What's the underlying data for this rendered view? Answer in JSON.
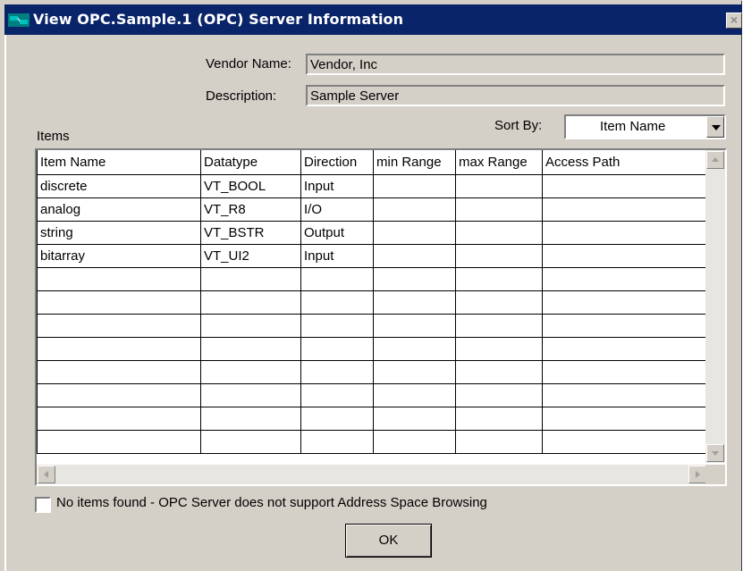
{
  "window": {
    "title": "View OPC.Sample.1 (OPC) Server Information",
    "close_glyph": "×"
  },
  "vendor": {
    "label": "Vendor Name:",
    "value": "Vendor, Inc"
  },
  "description": {
    "label": "Description:",
    "value": "Sample Server"
  },
  "items_label": "Items",
  "sort": {
    "label": "Sort By:",
    "selected": "Item Name"
  },
  "table": {
    "columns": [
      "Item Name",
      "Datatype",
      "Direction",
      "min Range",
      "max Range",
      "Access Path"
    ],
    "rows": [
      [
        "discrete",
        "VT_BOOL",
        "Input",
        "",
        "",
        ""
      ],
      [
        "analog",
        "VT_R8",
        "I/O",
        "",
        "",
        ""
      ],
      [
        "string",
        "VT_BSTR",
        "Output",
        "",
        "",
        ""
      ],
      [
        "bitarray",
        "VT_UI2",
        "Input",
        "",
        "",
        ""
      ],
      [
        "",
        "",
        "",
        "",
        "",
        ""
      ],
      [
        "",
        "",
        "",
        "",
        "",
        ""
      ],
      [
        "",
        "",
        "",
        "",
        "",
        ""
      ],
      [
        "",
        "",
        "",
        "",
        "",
        ""
      ],
      [
        "",
        "",
        "",
        "",
        "",
        ""
      ],
      [
        "",
        "",
        "",
        "",
        "",
        ""
      ],
      [
        "",
        "",
        "",
        "",
        "",
        ""
      ],
      [
        "",
        "",
        "",
        "",
        "",
        ""
      ]
    ]
  },
  "no_items_checkbox": {
    "label": "No items found - OPC Server does not support Address Space Browsing",
    "checked": false
  },
  "ok_button": "OK",
  "colors": {
    "title_bar": "#0a246a",
    "dialog_face": "#d4d0c8"
  },
  "icons": {
    "title": "opc-server-icon",
    "close": "close-icon",
    "dropdown": "chevron-down-icon"
  }
}
